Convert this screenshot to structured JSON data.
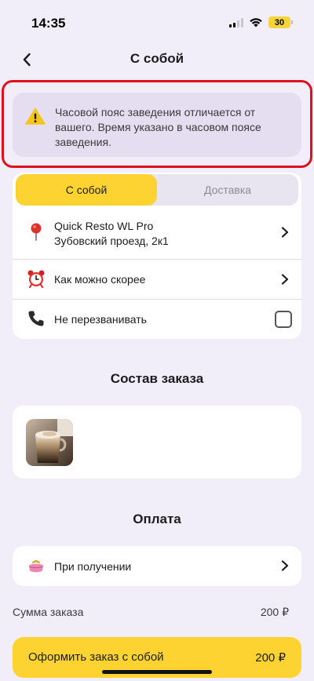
{
  "status_bar": {
    "time": "14:35",
    "battery": "30"
  },
  "header": {
    "title": "С собой"
  },
  "warning": {
    "text": "Часовой пояс заведения отличается от вашего. Время указано в часовом поясе заведения."
  },
  "order_type": {
    "tabs": [
      {
        "label": "С собой",
        "active": true
      },
      {
        "label": "Доставка",
        "active": false
      }
    ]
  },
  "details": {
    "location": {
      "name": "Quick Resto WL Pro",
      "address": "Зубовский проезд, 2к1"
    },
    "time": {
      "label": "Как можно скорее"
    },
    "callback": {
      "label": "Не перезванивать",
      "checked": false
    }
  },
  "composition": {
    "title": "Состав заказа"
  },
  "payment": {
    "title": "Оплата",
    "method": "При получении"
  },
  "summary": {
    "label": "Сумма заказа",
    "value": "200 ₽"
  },
  "checkout": {
    "label": "Оформить заказ с собой",
    "total": "200 ₽"
  },
  "colors": {
    "accent": "#fdd332",
    "background": "#f2eef9",
    "highlight": "#e0101e"
  }
}
